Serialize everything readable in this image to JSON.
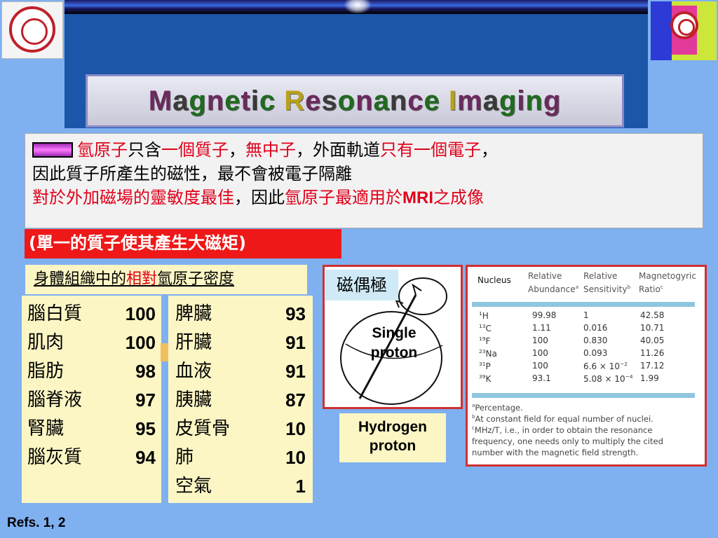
{
  "header": {
    "title_letters": [
      {
        "ch": "M",
        "color": "#6b2a5e"
      },
      {
        "ch": "a",
        "color": "#3a3a3a"
      },
      {
        "ch": "g",
        "color": "#1f6b1f"
      },
      {
        "ch": "n",
        "color": "#6b2a5e"
      },
      {
        "ch": "e",
        "color": "#1f6b1f"
      },
      {
        "ch": "t",
        "color": "#6b2a5e"
      },
      {
        "ch": "i",
        "color": "#3a3a3a"
      },
      {
        "ch": "c",
        "color": "#1f6b1f"
      },
      {
        "ch": " ",
        "color": "#000"
      },
      {
        "ch": "R",
        "color": "#b7a21a"
      },
      {
        "ch": "e",
        "color": "#6b2a5e"
      },
      {
        "ch": "s",
        "color": "#3a3a3a"
      },
      {
        "ch": "o",
        "color": "#1f6b1f"
      },
      {
        "ch": "n",
        "color": "#6b2a5e"
      },
      {
        "ch": "a",
        "color": "#1f6b1f"
      },
      {
        "ch": "n",
        "color": "#3a3a3a"
      },
      {
        "ch": "c",
        "color": "#6b2a5e"
      },
      {
        "ch": "e",
        "color": "#1f6b1f"
      },
      {
        "ch": " ",
        "color": "#000"
      },
      {
        "ch": "I",
        "color": "#b7a21a"
      },
      {
        "ch": "m",
        "color": "#6b2a5e"
      },
      {
        "ch": "a",
        "color": "#3a3a3a"
      },
      {
        "ch": "g",
        "color": "#1f6b1f"
      },
      {
        "ch": "i",
        "color": "#6b2a5e"
      },
      {
        "ch": "n",
        "color": "#1f6b1f"
      },
      {
        "ch": "g",
        "color": "#6b2a5e"
      }
    ]
  },
  "intro": {
    "l1_a": "氫原子",
    "l1_b": "只含",
    "l1_c": "一個質子",
    "l1_d": "，",
    "l1_e": "無中子",
    "l1_f": "，外面軌道",
    "l1_g": "只有一個電子",
    "l1_h": "，",
    "l2": "因此質子所產生的磁性，最不會被電子隔離",
    "l3_a": "對於外加磁場的靈敏度最佳",
    "l3_b": "，因此",
    "l3_c": "氫原子最適用於",
    "l3_d": "MRI",
    "l3_e": "之成像"
  },
  "note": "(單一的質子使其產生大磁矩)",
  "density": {
    "heading_a": "身體組織中的",
    "heading_b": "相對",
    "heading_c": "氫原子密度",
    "left": [
      {
        "name": "腦白質",
        "value": "100"
      },
      {
        "name": "肌肉",
        "value": "100"
      },
      {
        "name": "脂肪",
        "value": "98"
      },
      {
        "name": "腦脊液",
        "value": "97"
      },
      {
        "name": "腎臟",
        "value": "95"
      },
      {
        "name": "腦灰質",
        "value": "94"
      }
    ],
    "right": [
      {
        "name": "脾臟",
        "value": "93"
      },
      {
        "name": "肝臟",
        "value": "91"
      },
      {
        "name": "血液",
        "value": "91"
      },
      {
        "name": "胰臟",
        "value": "87"
      },
      {
        "name": "皮質骨",
        "value": "10"
      },
      {
        "name": "肺",
        "value": "10"
      },
      {
        "name": "空氣",
        "value": "1"
      }
    ]
  },
  "diagram": {
    "dipole": "磁偶極",
    "single_1": "Single",
    "single_2": "proton",
    "hydrogen_1": "Hydrogen",
    "hydrogen_2": "proton"
  },
  "nucleus_table": {
    "headers": {
      "nucleus": "Nucleus",
      "abundance_1": "Relative",
      "abundance_2": "Abundance",
      "abundance_mark": "a",
      "sensitivity_1": "Relative",
      "sensitivity_2": "Sensitivity",
      "sensitivity_mark": "b",
      "ratio_1": "Magnetogyric",
      "ratio_2": "Ratio",
      "ratio_mark": "c"
    },
    "rows": [
      {
        "mass": "1",
        "el": "H",
        "abundance": "99.98",
        "sensitivity": "1",
        "sens_exp": "",
        "ratio": "42.58"
      },
      {
        "mass": "13",
        "el": "C",
        "abundance": "1.11",
        "sensitivity": "0.016",
        "sens_exp": "",
        "ratio": "10.71"
      },
      {
        "mass": "19",
        "el": "F",
        "abundance": "100",
        "sensitivity": "0.830",
        "sens_exp": "",
        "ratio": "40.05"
      },
      {
        "mass": "23",
        "el": "Na",
        "abundance": "100",
        "sensitivity": "0.093",
        "sens_exp": "",
        "ratio": "11.26"
      },
      {
        "mass": "31",
        "el": "P",
        "abundance": "100",
        "sensitivity": "6.6 × 10",
        "sens_exp": "−2",
        "ratio": "17.12"
      },
      {
        "mass": "39",
        "el": "K",
        "abundance": "93.1",
        "sensitivity": "5.08 × 10",
        "sens_exp": "−4",
        "ratio": "1.99"
      }
    ],
    "footnotes": [
      {
        "mark": "a",
        "text": "Percentage."
      },
      {
        "mark": "b",
        "text": "At constant field for equal number of nuclei."
      },
      {
        "mark": "c",
        "text": "MHz/T, i.e., in order to obtain the resonance frequency, one needs only to multiply the cited number with the magnetic field strength."
      }
    ]
  },
  "refs": "Refs. 1, 2",
  "colors": {
    "accent_red": "#e0001a",
    "panel_yellow": "#fbf6c4",
    "background": "#7fb0f0"
  }
}
